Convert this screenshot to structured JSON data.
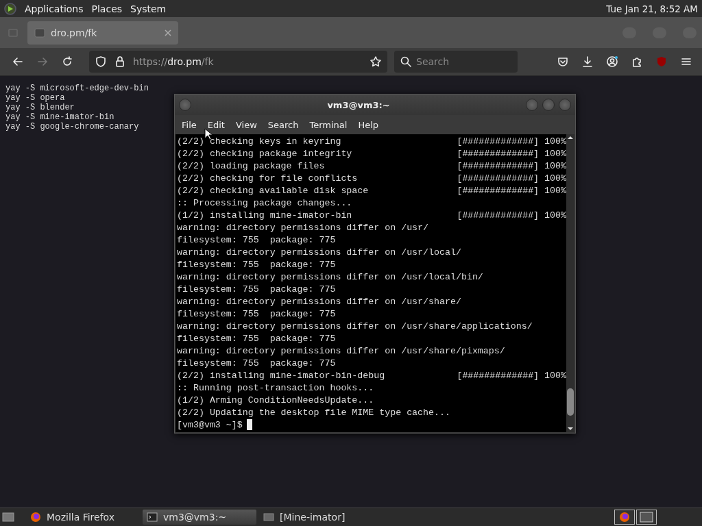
{
  "top_panel": {
    "menus": [
      "Applications",
      "Places",
      "System"
    ],
    "clock": "Tue Jan 21, 8:52 AM"
  },
  "browser": {
    "tabs": [
      {
        "title": "dro.pm/fk",
        "selected": true
      }
    ],
    "url": {
      "scheme": "https://",
      "host": "dro.pm",
      "path": "/fk"
    },
    "search": {
      "placeholder": "Search"
    }
  },
  "page": {
    "lines": [
      "yay -S microsoft-edge-dev-bin",
      "yay -S opera",
      "yay -S blender",
      "yay -S mine-imator-bin",
      "yay -S google-chrome-canary"
    ]
  },
  "terminal": {
    "title": "vm3@vm3:~",
    "menu": [
      "File",
      "Edit",
      "View",
      "Search",
      "Terminal",
      "Help"
    ],
    "lines": [
      {
        "text": "(2/2) checking keys in keyring",
        "progress": "[#############] 100%"
      },
      {
        "text": "(2/2) checking package integrity",
        "progress": "[#############] 100%"
      },
      {
        "text": "(2/2) loading package files",
        "progress": "[#############] 100%"
      },
      {
        "text": "(2/2) checking for file conflicts",
        "progress": "[#############] 100%"
      },
      {
        "text": "(2/2) checking available disk space",
        "progress": "[#############] 100%"
      },
      {
        "text": ":: Processing package changes..."
      },
      {
        "text": "(1/2) installing mine-imator-bin",
        "progress": "[#############] 100%"
      },
      {
        "text": "warning: directory permissions differ on /usr/"
      },
      {
        "text": "filesystem: 755  package: 775"
      },
      {
        "text": "warning: directory permissions differ on /usr/local/"
      },
      {
        "text": "filesystem: 755  package: 775"
      },
      {
        "text": "warning: directory permissions differ on /usr/local/bin/"
      },
      {
        "text": "filesystem: 755  package: 775"
      },
      {
        "text": "warning: directory permissions differ on /usr/share/"
      },
      {
        "text": "filesystem: 755  package: 775"
      },
      {
        "text": "warning: directory permissions differ on /usr/share/applications/"
      },
      {
        "text": "filesystem: 755  package: 775"
      },
      {
        "text": "warning: directory permissions differ on /usr/share/pixmaps/"
      },
      {
        "text": "filesystem: 755  package: 775"
      },
      {
        "text": "(2/2) installing mine-imator-bin-debug",
        "progress": "[#############] 100%"
      },
      {
        "text": ":: Running post-transaction hooks..."
      },
      {
        "text": "(1/2) Arming ConditionNeedsUpdate..."
      },
      {
        "text": "(2/2) Updating the desktop file MIME type cache..."
      }
    ],
    "prompt": "[vm3@vm3 ~]$"
  },
  "taskbar": {
    "tasks": [
      {
        "label": "Mozilla Firefox",
        "kind": "firefox",
        "selected": false
      },
      {
        "label": "vm3@vm3:~",
        "kind": "terminal",
        "selected": true
      },
      {
        "label": "[Mine-imator]",
        "kind": "window",
        "selected": false
      }
    ]
  }
}
